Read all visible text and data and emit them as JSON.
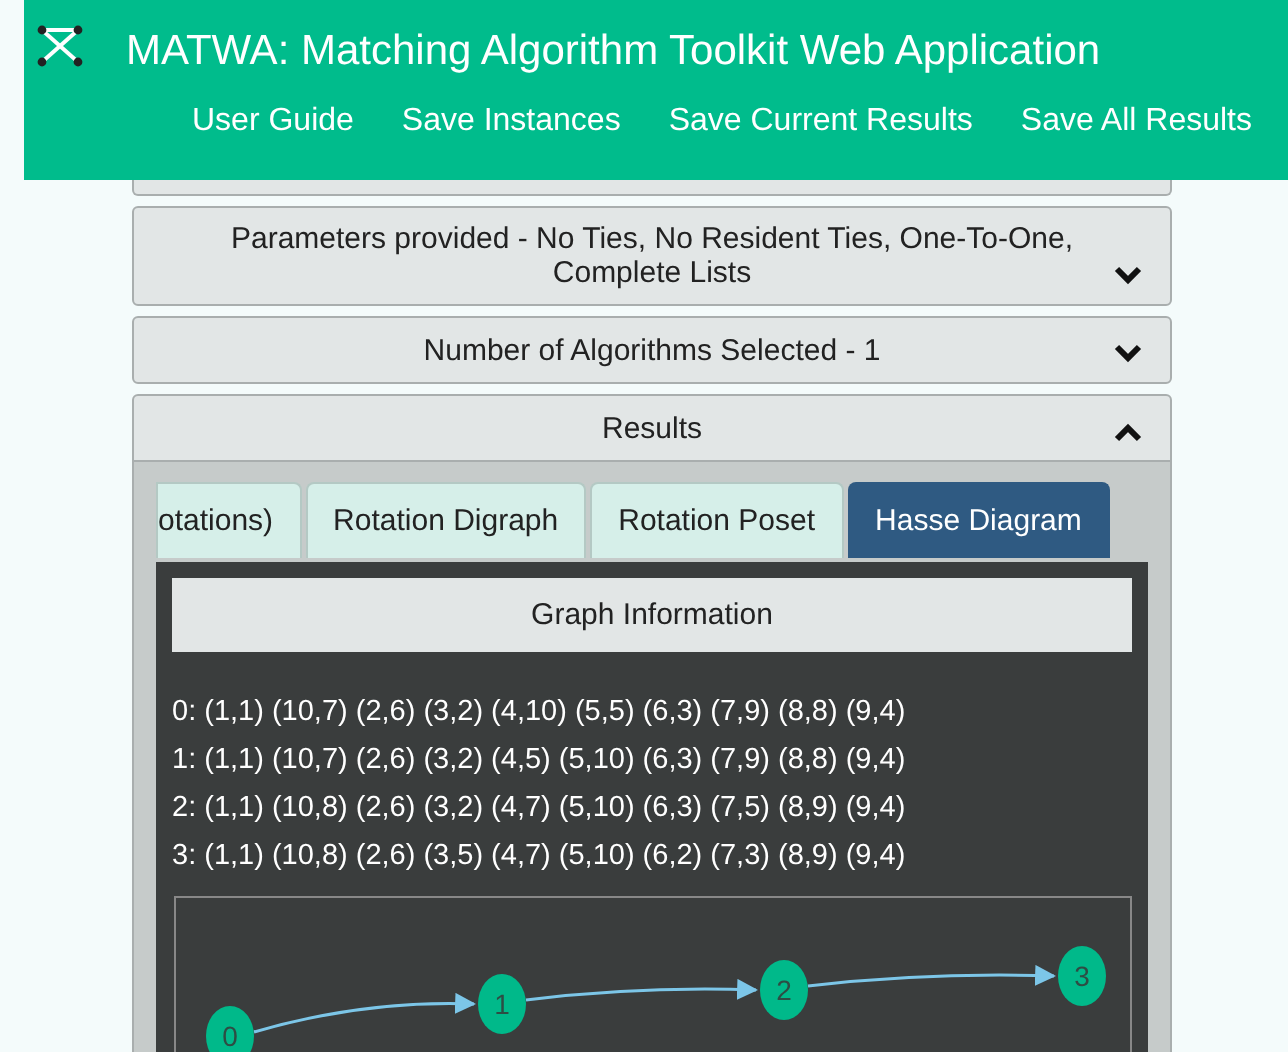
{
  "header": {
    "title": "MATWA: Matching Algorithm Toolkit Web Application",
    "nav": [
      "User Guide",
      "Save Instances",
      "Save Current Results",
      "Save All Results"
    ]
  },
  "panels": [
    {
      "label": "Parameters provided - No Ties, No Resident Ties, One-To-One, Complete Lists",
      "expanded": false
    },
    {
      "label": "Number of Algorithms Selected - 1",
      "expanded": false
    },
    {
      "label": "Results",
      "expanded": true
    }
  ],
  "tabs": [
    {
      "label": "otations)",
      "selected": false
    },
    {
      "label": "Rotation Digraph",
      "selected": false
    },
    {
      "label": "Rotation Poset",
      "selected": false
    },
    {
      "label": "Hasse Diagram",
      "selected": true
    }
  ],
  "graph_info": {
    "title": "Graph Information",
    "lines": [
      "0: (1,1) (10,7) (2,6) (3,2) (4,10) (5,5) (6,3) (7,9) (8,8) (9,4)",
      "1: (1,1) (10,7) (2,6) (3,2) (4,5) (5,10) (6,3) (7,9) (8,8) (9,4)",
      "2: (1,1) (10,8) (2,6) (3,2) (4,7) (5,10) (6,3) (7,5) (8,9) (9,4)",
      "3: (1,1) (10,8) (2,6) (3,5) (4,7) (5,10) (6,2) (7,3) (8,9) (9,4)"
    ]
  },
  "diagram": {
    "nodes": [
      "0",
      "1",
      "2",
      "3"
    ]
  }
}
